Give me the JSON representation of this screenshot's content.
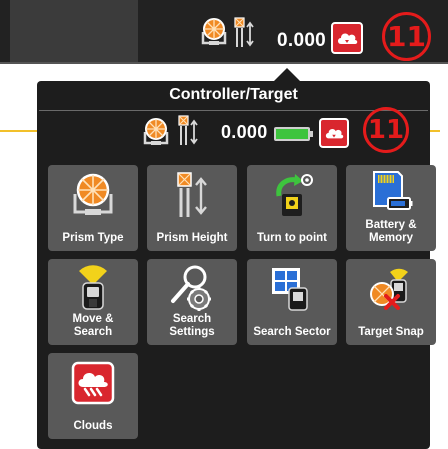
{
  "status_bar": {
    "value": "0.000",
    "callout_number": "11"
  },
  "popup": {
    "title": "Controller/Target",
    "value": "0.000",
    "callout_number": "11",
    "tiles": [
      {
        "label": "Prism Type",
        "icon": "prism-icon"
      },
      {
        "label": "Prism Height",
        "icon": "prism-height-icon"
      },
      {
        "label": "Turn to point",
        "icon": "turn-to-point-icon"
      },
      {
        "label": "Battery &\nMemory",
        "icon": "battery-memory-icon"
      },
      {
        "label": "Move &\nSearch",
        "icon": "move-search-icon"
      },
      {
        "label": "Search\nSettings",
        "icon": "search-settings-icon"
      },
      {
        "label": "Search Sector",
        "icon": "search-sector-icon"
      },
      {
        "label": "Target Snap",
        "icon": "target-snap-icon"
      },
      {
        "label": "Clouds",
        "icon": "clouds-icon"
      }
    ]
  },
  "colors": {
    "accent_red": "#d9262e",
    "prism_orange": "#f08a24",
    "battery_green": "#3ec43e",
    "map_line_yellow": "#f2c02a"
  }
}
